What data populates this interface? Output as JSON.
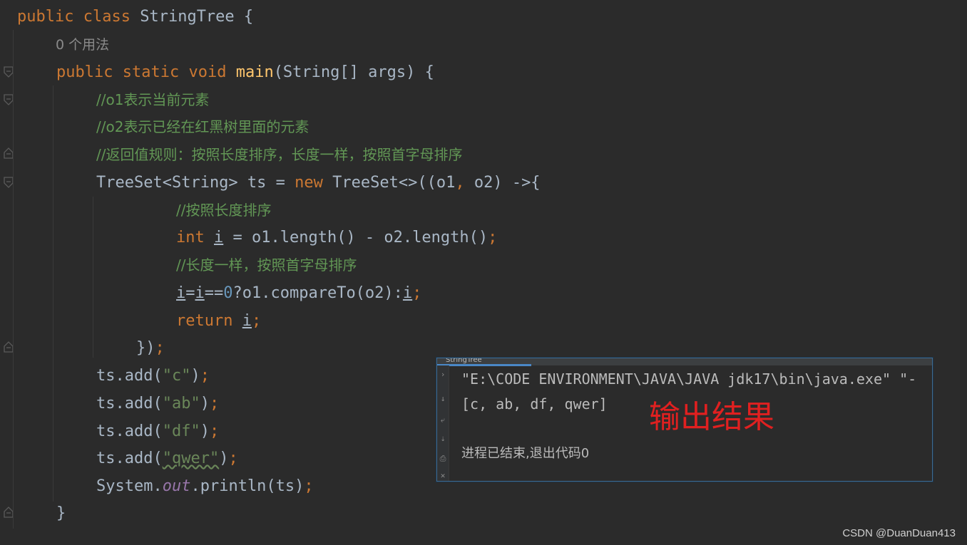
{
  "editor": {
    "usage_hint": "0 个用法",
    "lines": {
      "l1": {
        "kw_public": "public",
        "kw_class": "class",
        "name": "StringTree {"
      },
      "l3": {
        "kw_public": "public",
        "kw_static": "static",
        "kw_void": "void",
        "fn": "main",
        "rest": "(String[] args) {"
      },
      "l4": "//o1表示当前元素",
      "l5": "//o2表示已经在红黑树里面的元素",
      "l6": "//返回值规则：按照长度排序，长度一样，按照首字母排序",
      "l7": {
        "a": "TreeSet<String> ts = ",
        "kw_new": "new",
        "b": " TreeSet<>((o1",
        "comma": ",",
        "c": " o2) ->{"
      },
      "l8": "//按照长度排序",
      "l9": {
        "kw_int": "int",
        "var": "i",
        "rest": " = o1.length() - o2.length()",
        "semi": ";"
      },
      "l10": "//长度一样，按照首字母排序",
      "l11": {
        "v1": "i",
        "eq": "=",
        "v2": "i",
        "eqeq": "==",
        "num": "0",
        "mid": "?o1.compareTo(o2):",
        "v3": "i",
        "semi": ";"
      },
      "l12": {
        "kw_return": "return",
        "var": "i",
        "semi": ";"
      },
      "l13": {
        "close": "})",
        "semi": ";"
      },
      "add_lines": [
        {
          "pre": "ts.add(",
          "str": "\"c\"",
          "post": ")",
          "semi": ";"
        },
        {
          "pre": "ts.add(",
          "str": "\"ab\"",
          "post": ")",
          "semi": ";"
        },
        {
          "pre": "ts.add(",
          "str": "\"df\"",
          "post": ")",
          "semi": ";"
        },
        {
          "pre": "ts.add(",
          "str": "\"qwer\"",
          "post": ")",
          "semi": ";"
        }
      ],
      "l18": {
        "pre": "System.",
        "field": "out",
        "post": ".println(ts)",
        "semi": ";"
      },
      "l19": "}"
    }
  },
  "run_panel": {
    "tab_label": "StringTree",
    "command_line": "\"E:\\CODE ENVIRONMENT\\JAVA\\JAVA jdk17\\bin\\java.exe\" \"-",
    "output": "[c, ab, df, qwer]",
    "exit_message": "进程已结束,退出代码0"
  },
  "annotation": "输出结果",
  "watermark": "CSDN @DuanDuan413",
  "colors": {
    "background": "#2b2b2b",
    "keyword": "#cc7832",
    "function": "#ffc66d",
    "comment": "#629755",
    "string": "#6a8759",
    "number": "#6897bb",
    "field": "#9876aa",
    "text": "#a9b7c6",
    "annotation": "#e02020"
  }
}
